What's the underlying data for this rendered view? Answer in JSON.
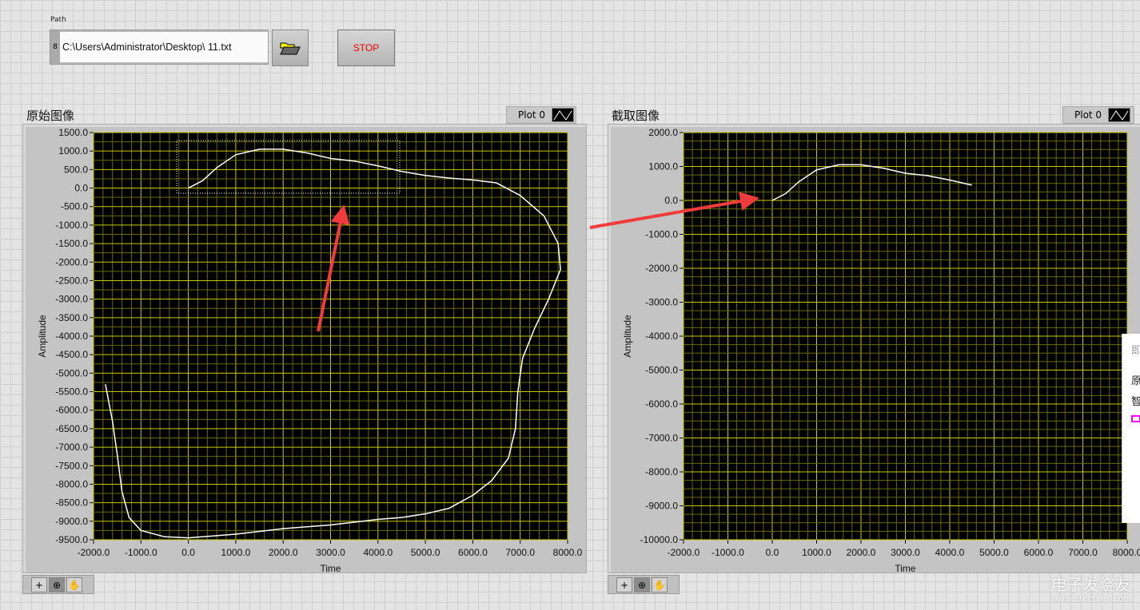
{
  "path_control": {
    "label": "Path",
    "value": "C:\\Users\\Administrator\\Desktop\\ 11.txt",
    "handle": "8"
  },
  "stop_button": {
    "label": "STOP"
  },
  "graphs": [
    {
      "title": "原始图像",
      "legend": "Plot 0",
      "xlabel": "Time",
      "ylabel": "Amplitude",
      "yticks": [
        "1500.0",
        "1000.0",
        "500.0",
        "0.0",
        "-500.0",
        "-1000.0",
        "-1500.0",
        "-2000.0",
        "-2500.0",
        "-3000.0",
        "-3500.0",
        "-4000.0",
        "-4500.0",
        "-5000.0",
        "-5500.0",
        "-6000.0",
        "-6500.0",
        "-7000.0",
        "-7500.0",
        "-8000.0",
        "-8500.0",
        "-9000.0",
        "-9500.0"
      ],
      "xticks": [
        "-2000.0",
        "-1000.0",
        "0.0",
        "1000.0",
        "2000.0",
        "3000.0",
        "4000.0",
        "5000.0",
        "6000.0",
        "7000.0",
        "8000.0"
      ]
    },
    {
      "title": "截取图像",
      "legend": "Plot 0",
      "xlabel": "Time",
      "ylabel": "Amplitude",
      "yticks": [
        "2000.0",
        "1000.0",
        "0.0",
        "-1000.0",
        "-2000.0",
        "-3000.0",
        "-4000.0",
        "-5000.0",
        "-6000.0",
        "-7000.0",
        "-8000.0",
        "-9000.0",
        "-10000.0"
      ],
      "xticks": [
        "-2000.0",
        "-1000.0",
        "0.0",
        "1000.0",
        "2000.0",
        "3000.0",
        "4000.0",
        "5000.0",
        "6000.0",
        "7000.0",
        "8000.0"
      ]
    }
  ],
  "chart_data": [
    {
      "type": "line",
      "title": "原始图像",
      "xlabel": "Time",
      "ylabel": "Amplitude",
      "xlim": [
        -2000,
        8000
      ],
      "ylim": [
        -9500,
        1500
      ],
      "grid": true,
      "legend": "top-right",
      "series": [
        {
          "name": "Plot 0",
          "color": "#ffffff",
          "points": [
            [
              0,
              0
            ],
            [
              300,
              200
            ],
            [
              600,
              550
            ],
            [
              1000,
              900
            ],
            [
              1500,
              1050
            ],
            [
              2000,
              1050
            ],
            [
              2500,
              950
            ],
            [
              3000,
              800
            ],
            [
              3500,
              730
            ],
            [
              4000,
              600
            ],
            [
              4500,
              450
            ],
            [
              5000,
              340
            ],
            [
              5500,
              270
            ],
            [
              6000,
              220
            ],
            [
              6500,
              140
            ],
            [
              7000,
              -200
            ],
            [
              7500,
              -750
            ],
            [
              7800,
              -1500
            ],
            [
              7850,
              -2200
            ],
            [
              7600,
              -3000
            ],
            [
              7300,
              -3800
            ],
            [
              7050,
              -4600
            ],
            [
              6950,
              -5500
            ],
            [
              6900,
              -6500
            ],
            [
              6750,
              -7300
            ],
            [
              6400,
              -7900
            ],
            [
              6000,
              -8300
            ],
            [
              5500,
              -8650
            ],
            [
              5000,
              -8800
            ],
            [
              4500,
              -8900
            ],
            [
              4000,
              -8950
            ],
            [
              3000,
              -9100
            ],
            [
              2000,
              -9200
            ],
            [
              1000,
              -9350
            ],
            [
              0,
              -9450
            ],
            [
              -500,
              -9420
            ],
            [
              -1000,
              -9250
            ],
            [
              -1250,
              -8900
            ],
            [
              -1400,
              -8200
            ],
            [
              -1500,
              -7200
            ],
            [
              -1600,
              -6300
            ],
            [
              -1750,
              -5300
            ]
          ]
        }
      ]
    },
    {
      "type": "line",
      "title": "截取图像",
      "xlabel": "Time",
      "ylabel": "Amplitude",
      "xlim": [
        -2000,
        8000
      ],
      "ylim": [
        -10000,
        2000
      ],
      "grid": true,
      "legend": "top-right",
      "series": [
        {
          "name": "Plot 0",
          "color": "#ffffff",
          "points": [
            [
              0,
              0
            ],
            [
              300,
              200
            ],
            [
              600,
              550
            ],
            [
              1000,
              900
            ],
            [
              1500,
              1050
            ],
            [
              2000,
              1050
            ],
            [
              2500,
              950
            ],
            [
              3000,
              800
            ],
            [
              3500,
              730
            ],
            [
              4000,
              600
            ],
            [
              4500,
              450
            ]
          ]
        }
      ]
    }
  ],
  "popup": {
    "lines": [
      "即",
      "原",
      "智"
    ]
  },
  "watermark": {
    "text": "电子发烧友",
    "url": "www.elecfans.com"
  },
  "colors": {
    "plot_bg": "#000000",
    "grid_major": "#c8c800",
    "grid_minor": "#6a6a00",
    "curve": "#ffffff",
    "arrow": "#f03c3c",
    "stop_text": "#ee0000"
  }
}
